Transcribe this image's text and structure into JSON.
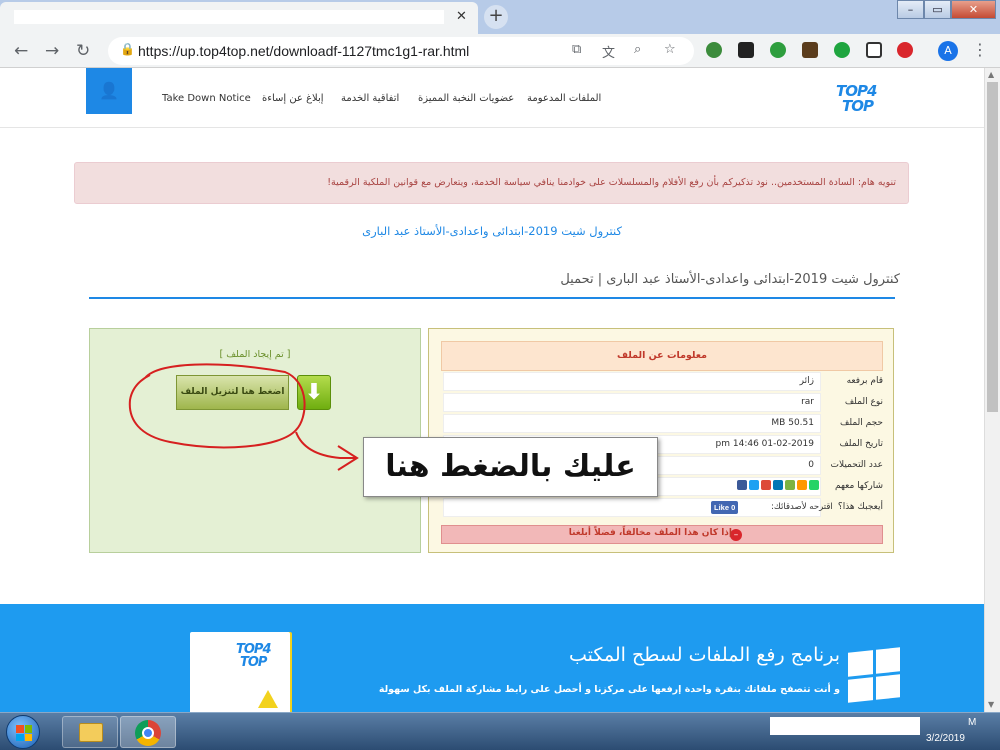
{
  "browser": {
    "tab_close": "✕",
    "new_tab": "+",
    "url": "https://up.top4top.net/downloadf-1127tmc1g1-rar.html",
    "window_buttons": {
      "minimize": "–",
      "maximize": "▭",
      "close": "✕"
    },
    "nav": {
      "back": "←",
      "forward": "→",
      "reload": "↻"
    },
    "lock_icon": "🔒",
    "profile_initial": "A",
    "menu": "⋮",
    "extension_icons": [
      "translate-icon",
      "zoom-icon",
      "star-icon",
      "ext-green-icon",
      "ext-box-icon",
      "ext-plus-icon",
      "ext-film-icon",
      "ext-circle-icon",
      "ext-x-icon",
      "ext-red-icon"
    ]
  },
  "site": {
    "logo_line1": "TOP4",
    "logo_line2": "TOP",
    "user_icon": "👤",
    "nav": [
      "الملفات المدعومة",
      "عضويات النخبة المميزة",
      "اتفاقية الخدمة",
      "إبلاغ عن إساءة",
      "Take Down Notice"
    ],
    "notice": "تنويه هام: السادة المستخدمين.. نود تذكيركم بأن رفع الأفلام والمسلسلات على خوادمنا ينافي سياسة الخدمة، ويتعارض مع قوانين الملكية الرقمية!",
    "link_title": "كنترول شيت 2019-ابتدائى واعدادى-الأستاذ عبد البارى",
    "page_title": "كنترول شيت 2019-ابتدائى واعدادى-الأستاذ عبد البارى | تحميل"
  },
  "file_info": {
    "header": "معلومات عن الملف",
    "rows": [
      {
        "label": "قام برفعه",
        "value": "زائر"
      },
      {
        "label": "نوع الملف",
        "value": "rar"
      },
      {
        "label": "حجم الملف",
        "value": "MB 50.51"
      },
      {
        "label": "تاريخ الملف",
        "value": "pm 14:46 01-02-2019"
      },
      {
        "label": "عدد التحميلات",
        "value": "0"
      },
      {
        "label": "شاركها معهم",
        "value": ""
      },
      {
        "label": "أيعجبك هذا؟",
        "value": ""
      }
    ],
    "suggest": "اقترحه لأصدقائك:",
    "like_label": "Like 0",
    "report": "إذا كان هذا الملف مخالفاً، فضلاً أبلغنا",
    "share_colors": [
      "#3b5998",
      "#1da1f2",
      "#dd4b39",
      "#0077b5",
      "#7cb342",
      "#ff9800",
      "#25d366"
    ]
  },
  "download": {
    "found": "[ تم إيجاد الملف ]",
    "button": "اضغط هنا لتنزيل الملف",
    "arrow_icon": "⬇"
  },
  "annotation": {
    "text": "عليك بالضغط هنا",
    "color": "#d62020"
  },
  "promo": {
    "title": "برنامج رفع الملفات لسطح المكتب",
    "subtitle": "و أنت تتصفح ملفاتك بنقرة واحدة إرفعها على مركزنا و أحصل على رابط مشاركة الملف بكل سهولة",
    "box_line1": "TOP4",
    "box_line2": "TOP"
  },
  "taskbar": {
    "clock_time": "M",
    "clock_date": "3/2/2019"
  }
}
